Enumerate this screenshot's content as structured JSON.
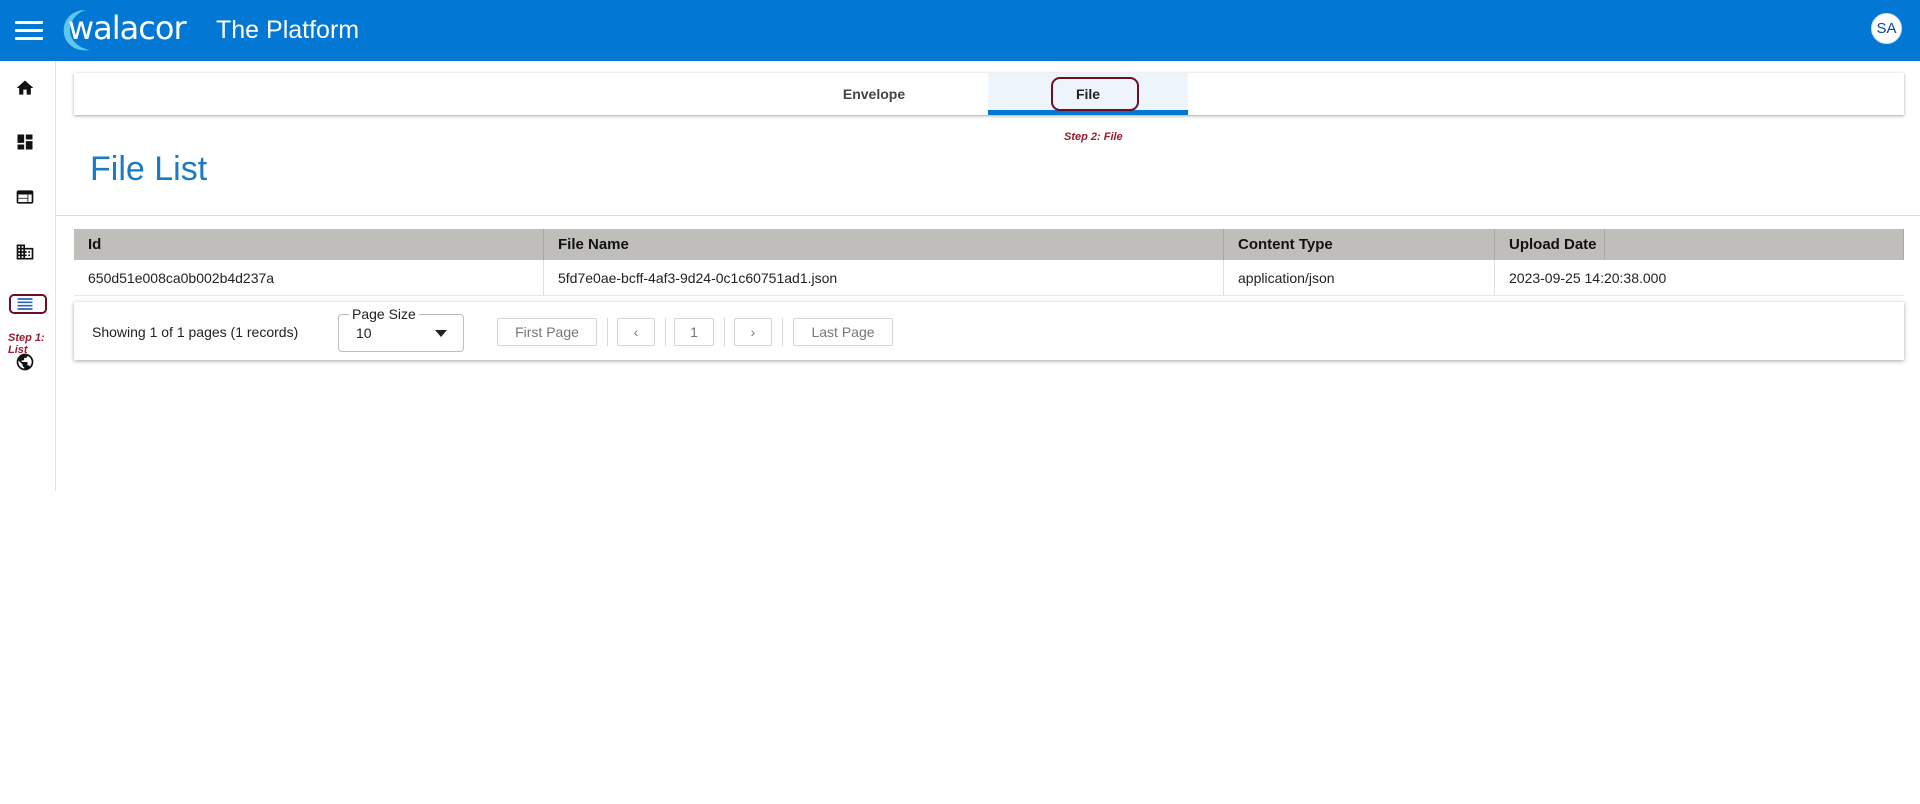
{
  "header": {
    "logo_text": "walacor",
    "title": "The Platform",
    "avatar_initials": "SA",
    "brand_color": "#0277d4"
  },
  "sidebar": {
    "items": [
      {
        "icon": "home-icon"
      },
      {
        "icon": "dashboard-icon"
      },
      {
        "icon": "browser-window-icon"
      },
      {
        "icon": "building-icon"
      },
      {
        "icon": "list-icon"
      },
      {
        "icon": "globe-icon"
      }
    ],
    "annotation": "Step 1: List"
  },
  "tabs": {
    "items": [
      {
        "label": "Envelope",
        "active": false
      },
      {
        "label": "File",
        "active": true
      }
    ],
    "annotation": "Step 2: File"
  },
  "page": {
    "title": "File List"
  },
  "table": {
    "columns": [
      "Id",
      "File Name",
      "Content Type",
      "Upload Date"
    ],
    "rows": [
      [
        "650d51e008ca0b002b4d237a",
        "5fd7e0ae-bcff-4af3-9d24-0c1c60751ad1.json",
        "application/json",
        "2023-09-25 14:20:38.000"
      ]
    ]
  },
  "pager": {
    "showing_text": "Showing 1 of 1 pages (1 records)",
    "page_size_label": "Page Size",
    "page_size_value": "10",
    "first_label": "First Page",
    "prev_label": "‹",
    "current_page": "1",
    "next_label": "›",
    "last_label": "Last Page"
  }
}
